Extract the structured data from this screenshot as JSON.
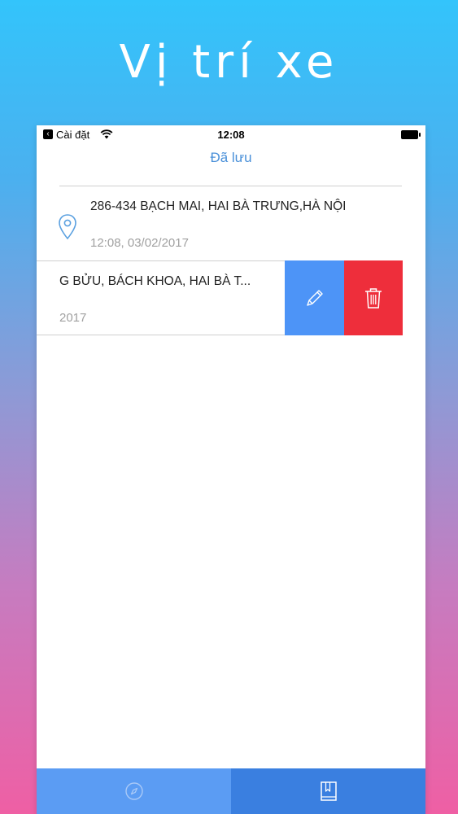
{
  "promo": {
    "title": "Vị trí xe"
  },
  "status_bar": {
    "back_label": "Cài đặt",
    "time": "12:08"
  },
  "nav": {
    "title": "Đã lưu"
  },
  "saved_locations": [
    {
      "address": "286-434 BẠCH MAI, HAI BÀ TRƯNG,HÀ NỘI",
      "time": "12:08, 03/02/2017"
    },
    {
      "address": "G BỬU, BÁCH KHOA, HAI BÀ T...",
      "time": "2017"
    }
  ],
  "colors": {
    "accent": "#4a90d9",
    "edit_action": "#4d94f7",
    "delete_action": "#ee2e3b",
    "tab_inactive": "#5b9cf3",
    "tab_active": "#3a7fe0"
  },
  "icons": {
    "pin": "location-pin-icon",
    "edit": "pencil-icon",
    "delete": "trash-icon",
    "tab_1": "compass-icon",
    "tab_2": "bookmark-book-icon"
  }
}
